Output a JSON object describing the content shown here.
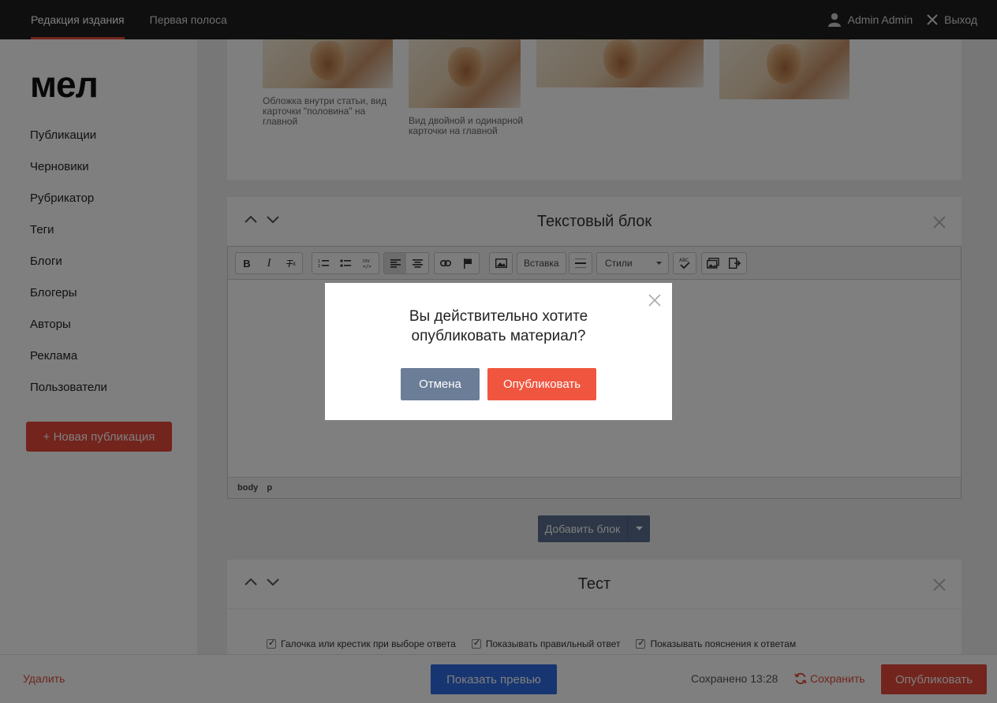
{
  "topbar": {
    "tabs": [
      {
        "label": "Редакция издания",
        "active": true
      },
      {
        "label": "Первая полоса",
        "active": false
      }
    ],
    "user_name": "Admin Admin",
    "logout_label": "Выход"
  },
  "sidebar": {
    "logo": "мел",
    "items": [
      {
        "label": "Публикации"
      },
      {
        "label": "Черновики"
      },
      {
        "label": "Рубрикатор"
      },
      {
        "label": "Теги"
      },
      {
        "label": "Блоги"
      },
      {
        "label": "Блогеры"
      },
      {
        "label": "Авторы"
      },
      {
        "label": "Реклама"
      },
      {
        "label": "Пользователи"
      }
    ],
    "new_publication_label": "+ Новая публикация"
  },
  "cover_block": {
    "captions": [
      "Обложка внутри статьи, вид карточки \"половина\" на главной",
      "Вид двойной и одинарной карточки на главной"
    ]
  },
  "text_block": {
    "title": "Текстовый блок",
    "toolbar": {
      "insert_label": "Вставка",
      "styles_label": "Стили"
    },
    "statusbar": [
      "body",
      "p"
    ]
  },
  "add_block_label": "Добавить блок",
  "test_block": {
    "title": "Тест",
    "checkboxes": [
      {
        "label": "Галочка или крестик при выборе ответа",
        "checked": true
      },
      {
        "label": "Показывать правильный ответ",
        "checked": true
      },
      {
        "label": "Показывать пояснения к ответам",
        "checked": true
      }
    ]
  },
  "bottombar": {
    "delete_label": "Удалить",
    "preview_label": "Показать превью",
    "saved_status": "Сохранено 13:28",
    "save_label": "Сохранить",
    "publish_label": "Опубликовать"
  },
  "modal": {
    "question_line1": "Вы действительно хотите",
    "question_line2": "опубликовать материал?",
    "cancel_label": "Отмена",
    "confirm_label": "Опубликовать"
  },
  "colors": {
    "accent_red": "#e5483a",
    "preview_blue": "#2e6be0",
    "cancel_gray": "#6b7d97",
    "add_block_blue": "#5a6e8e"
  }
}
